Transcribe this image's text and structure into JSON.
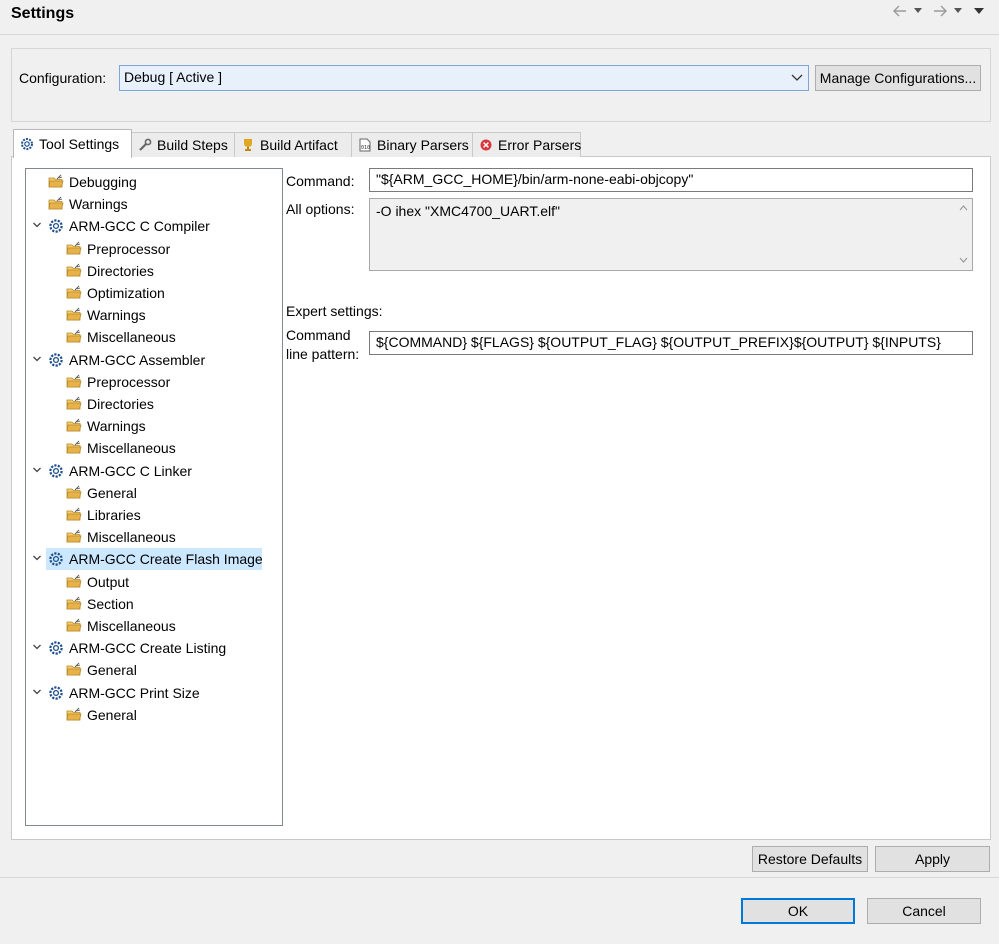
{
  "header": {
    "title": "Settings",
    "nav": {
      "back_icon": "back-arrow-icon",
      "forward_icon": "forward-arrow-icon",
      "menu_icon": "view-menu-icon"
    }
  },
  "configuration": {
    "label": "Configuration:",
    "value": "Debug  [ Active ]",
    "manage_label": "Manage Configurations..."
  },
  "tabs": [
    {
      "label": "Tool Settings",
      "icon": "gear-icon",
      "active": true
    },
    {
      "label": "Build Steps",
      "icon": "wrench-icon",
      "active": false
    },
    {
      "label": "Build Artifact",
      "icon": "trophy-icon",
      "active": false
    },
    {
      "label": "Binary Parsers",
      "icon": "binary-file-icon",
      "active": false
    },
    {
      "label": "Error Parsers",
      "icon": "error-icon",
      "active": false
    }
  ],
  "tree": {
    "items": [
      {
        "label": "Debugging",
        "level": 1,
        "icon": "options-folder-icon"
      },
      {
        "label": "Warnings",
        "level": 1,
        "icon": "options-folder-icon"
      },
      {
        "label": "ARM-GCC C Compiler",
        "level": 0,
        "icon": "tool-gear-icon",
        "expanded": true
      },
      {
        "label": "Preprocessor",
        "level": 2,
        "icon": "options-folder-icon"
      },
      {
        "label": "Directories",
        "level": 2,
        "icon": "options-folder-icon"
      },
      {
        "label": "Optimization",
        "level": 2,
        "icon": "options-folder-icon"
      },
      {
        "label": "Warnings",
        "level": 2,
        "icon": "options-folder-icon"
      },
      {
        "label": "Miscellaneous",
        "level": 2,
        "icon": "options-folder-icon"
      },
      {
        "label": "ARM-GCC Assembler",
        "level": 0,
        "icon": "tool-gear-icon",
        "expanded": true
      },
      {
        "label": "Preprocessor",
        "level": 2,
        "icon": "options-folder-icon"
      },
      {
        "label": "Directories",
        "level": 2,
        "icon": "options-folder-icon"
      },
      {
        "label": "Warnings",
        "level": 2,
        "icon": "options-folder-icon"
      },
      {
        "label": "Miscellaneous",
        "level": 2,
        "icon": "options-folder-icon"
      },
      {
        "label": "ARM-GCC C Linker",
        "level": 0,
        "icon": "tool-gear-icon",
        "expanded": true
      },
      {
        "label": "General",
        "level": 2,
        "icon": "options-folder-icon"
      },
      {
        "label": "Libraries",
        "level": 2,
        "icon": "options-folder-icon"
      },
      {
        "label": "Miscellaneous",
        "level": 2,
        "icon": "options-folder-icon"
      },
      {
        "label": "ARM-GCC Create Flash Image",
        "level": 0,
        "icon": "tool-gear-icon",
        "expanded": true,
        "selected": true
      },
      {
        "label": "Output",
        "level": 2,
        "icon": "options-folder-icon"
      },
      {
        "label": "Section",
        "level": 2,
        "icon": "options-folder-icon"
      },
      {
        "label": "Miscellaneous",
        "level": 2,
        "icon": "options-folder-icon"
      },
      {
        "label": "ARM-GCC Create Listing",
        "level": 0,
        "icon": "tool-gear-icon",
        "expanded": true
      },
      {
        "label": "General",
        "level": 2,
        "icon": "options-folder-icon"
      },
      {
        "label": "ARM-GCC Print Size",
        "level": 0,
        "icon": "tool-gear-icon",
        "expanded": true
      },
      {
        "label": "General",
        "level": 2,
        "icon": "options-folder-icon"
      }
    ]
  },
  "form": {
    "command_label": "Command:",
    "command_value": "\"${ARM_GCC_HOME}/bin/arm-none-eabi-objcopy\"",
    "all_options_label": "All options:",
    "all_options_value": "-O ihex \"XMC4700_UART.elf\"",
    "expert_label": "Expert settings:",
    "pattern_label_line1": "Command",
    "pattern_label_line2": "line pattern:",
    "pattern_value": "${COMMAND} ${FLAGS} ${OUTPUT_FLAG} ${OUTPUT_PREFIX}${OUTPUT} ${INPUTS}"
  },
  "buttons": {
    "restore_defaults": "Restore Defaults",
    "apply": "Apply",
    "ok": "OK",
    "cancel": "Cancel"
  },
  "colors": {
    "selection": "#cce8ff",
    "focus_border": "#0078d7",
    "gear_icon": "#1f4e8c",
    "folder_icon": "#e8b24a"
  }
}
